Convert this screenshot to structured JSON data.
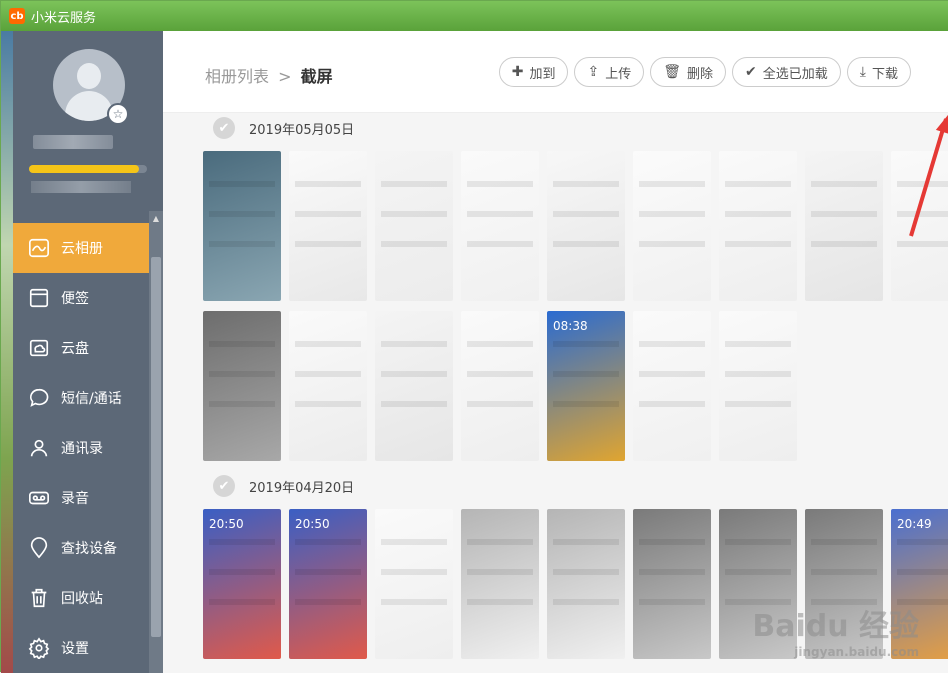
{
  "window": {
    "title": "小米云服务",
    "logo_text": "cb"
  },
  "sidebar": {
    "quota_fraction": 0.93,
    "items": [
      {
        "label": "云相册",
        "icon": "photo-album-icon",
        "active": true
      },
      {
        "label": "便签",
        "icon": "note-icon",
        "active": false
      },
      {
        "label": "云盘",
        "icon": "cloud-drive-icon",
        "active": false
      },
      {
        "label": "短信/通话",
        "icon": "chat-icon",
        "active": false
      },
      {
        "label": "通讯录",
        "icon": "contacts-icon",
        "active": false
      },
      {
        "label": "录音",
        "icon": "recorder-icon",
        "active": false
      },
      {
        "label": "查找设备",
        "icon": "location-pin-icon",
        "active": false
      },
      {
        "label": "回收站",
        "icon": "trash-icon",
        "active": false
      },
      {
        "label": "设置",
        "icon": "gear-icon",
        "active": false
      }
    ]
  },
  "header": {
    "breadcrumb_parent": "相册列表",
    "breadcrumb_sep": ">",
    "breadcrumb_current": "截屏"
  },
  "toolbar": {
    "add_label": "加到",
    "upload_label": "上传",
    "delete_label": "删除",
    "select_all_label": "全选已加载",
    "download_label": "下载"
  },
  "groups": [
    {
      "date": "2019年05月05日"
    },
    {
      "date": "2019年04月20日"
    }
  ],
  "thumb_times": [
    "08:38",
    "20:50",
    "20:50",
    "20:49"
  ],
  "watermark": {
    "text": "Baidu 经验",
    "sub": "jingyan.baidu.com"
  },
  "colors": {
    "accent": "#f0a93b",
    "sidebar": "#5c6877",
    "titlebar": "#5aa23a",
    "arrow": "#e53935"
  }
}
